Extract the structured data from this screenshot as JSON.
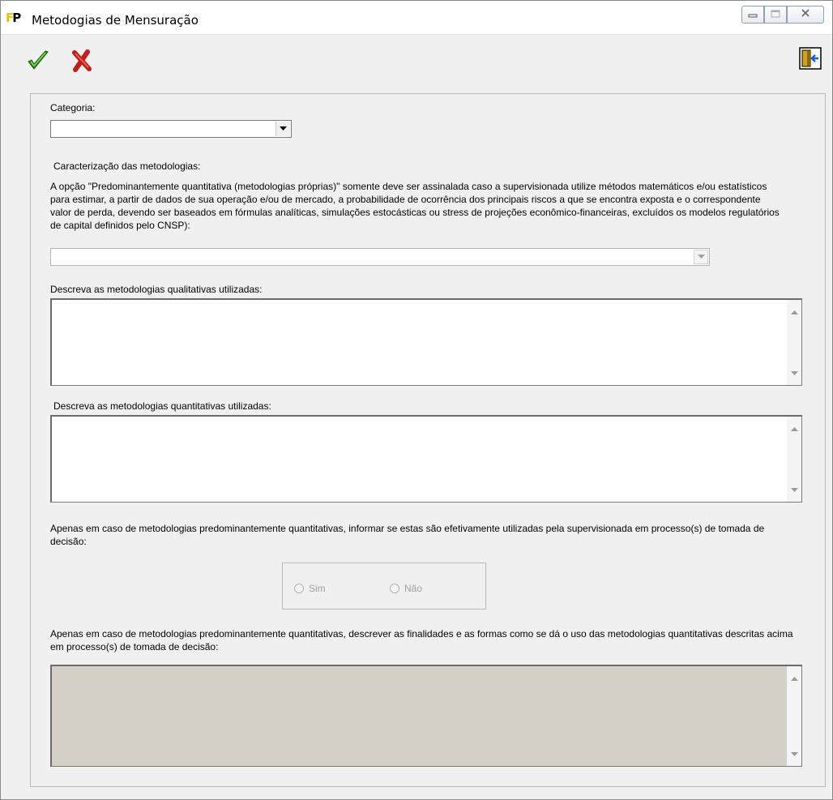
{
  "window": {
    "title": "Metodogias de Mensuração",
    "icon": "fp-app-icon",
    "controls": [
      "minimize-icon",
      "maximize-icon",
      "close-icon"
    ]
  },
  "toolbar": {
    "confirm_icon": "checkmark-icon",
    "cancel_icon": "x-icon",
    "exit_icon": "exit-door-icon",
    "confirm_color": "#2e8b1e",
    "cancel_color": "#c0201a"
  },
  "form": {
    "categoria_label": "Categoria:",
    "categoria_value": "",
    "caracterizacao_label": "Caracterização das metodologias:",
    "caracterizacao_text": "A opção \"Predominantemente quantitativa (metodologias próprias)\" somente deve ser assinalada caso a supervisionada utilize métodos matemáticos e/ou estatísticos para estimar, a partir de dados de sua operação e/ou de mercado, a probabilidade de ocorrência dos principais riscos a que se encontra exposta e o correspondente valor de perda, devendo ser baseados em fórmulas analíticas, simulações estocásticas ou stress de projeções econômico-financeiras, excluídos os modelos regulatórios de capital definidos pelo CNSP):",
    "caracterizacao_value": "",
    "qualitativas_label": "Descreva as metodologias qualitativas utilizadas:",
    "qualitativas_value": "",
    "quantitativas_label": "Descreva as metodologias quantitativas utilizadas:",
    "quantitativas_value": "",
    "decisao_question": "Apenas em caso de metodologias predominantemente quantitativas, informar se estas são efetivamente utilizadas pela supervisionada em processo(s) de tomada de decisão:",
    "radio_sim": "Sim",
    "radio_nao": "Não",
    "finalidades_label": "Apenas em caso de metodologias predominantemente quantitativas, descrever as finalidades e as formas como se dá o uso das metodologias quantitativas descritas acima em processo(s) de tomada de decisão:",
    "finalidades_value": ""
  }
}
